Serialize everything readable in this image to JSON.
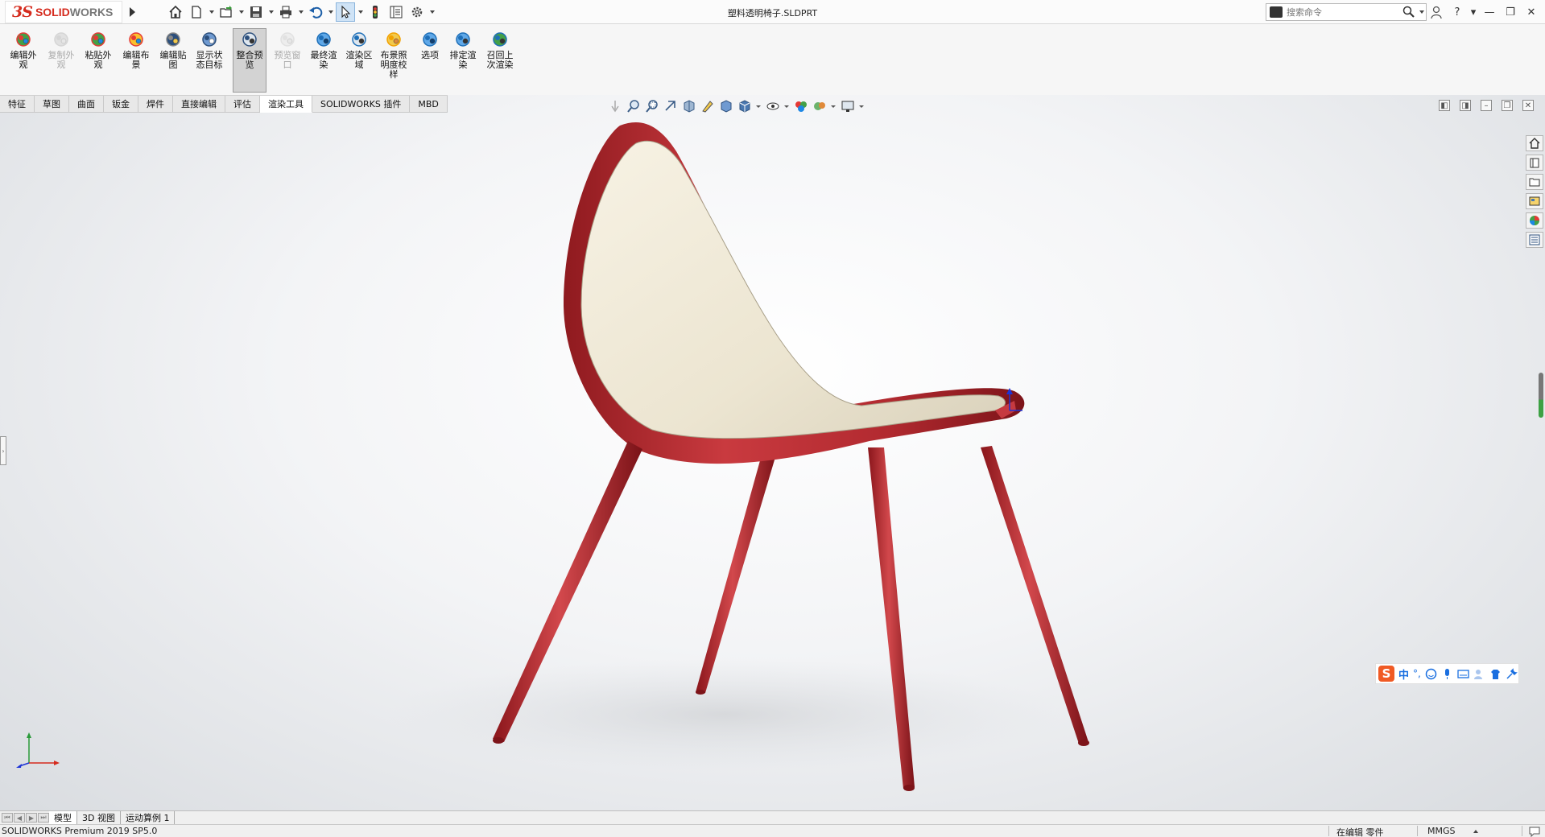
{
  "app": {
    "brand_ds": "3S",
    "brand_name_a": "SOLID",
    "brand_name_b": "WORKS",
    "document_title": "塑料透明椅子.SLDPRT"
  },
  "search": {
    "placeholder": "搜索命令"
  },
  "quick_access": [
    "home-icon",
    "new-document-icon",
    "open-icon",
    "save-icon",
    "print-icon",
    "undo-icon",
    "select-pointer-icon",
    "rebuild-icon",
    "file-properties-icon",
    "options-gear-icon"
  ],
  "ribbon": {
    "buttons": [
      {
        "label": "编辑外\n观",
        "icon": "edit-appearance-icon",
        "disabled": false
      },
      {
        "label": "复制外\n观",
        "icon": "copy-appearance-icon",
        "disabled": true
      },
      {
        "label": "粘贴外\n观",
        "icon": "paste-appearance-icon",
        "disabled": false
      },
      {
        "label": "编辑布\n景",
        "icon": "edit-scene-icon",
        "disabled": false
      },
      {
        "label": "编辑贴\n图",
        "icon": "edit-decal-icon",
        "disabled": false
      },
      {
        "label": "显示状\n态目标",
        "icon": "display-state-target-icon",
        "disabled": false
      },
      {
        "label": "整合预\n览",
        "icon": "integrated-preview-icon",
        "disabled": false,
        "pressed": true
      },
      {
        "label": "预览窗\n口",
        "icon": "preview-window-icon",
        "disabled": true
      },
      {
        "label": "最终渲\n染",
        "icon": "final-render-icon",
        "disabled": false
      },
      {
        "label": "渲染区\n域",
        "icon": "render-region-icon",
        "disabled": false
      },
      {
        "label": "布景照\n明度校\n样",
        "icon": "scene-illumination-proof-icon",
        "disabled": false
      },
      {
        "label": "选项",
        "icon": "render-options-icon",
        "disabled": false
      },
      {
        "label": "排定渲\n染",
        "icon": "schedule-render-icon",
        "disabled": false
      },
      {
        "label": "召回上\n次渲染",
        "icon": "recall-last-render-icon",
        "disabled": false
      }
    ]
  },
  "tabs": [
    {
      "label": "特征",
      "active": false
    },
    {
      "label": "草图",
      "active": false
    },
    {
      "label": "曲面",
      "active": false
    },
    {
      "label": "钣金",
      "active": false
    },
    {
      "label": "焊件",
      "active": false
    },
    {
      "label": "直接编辑",
      "active": false
    },
    {
      "label": "评估",
      "active": false
    },
    {
      "label": "渲染工具",
      "active": true
    },
    {
      "label": "SOLIDWORKS 插件",
      "active": false
    },
    {
      "label": "MBD",
      "active": false
    }
  ],
  "heads_up_toolbar": [
    "zoom-to-fit-icon",
    "zoom-area-icon",
    "previous-view-icon",
    "section-view-icon",
    "dynamic-annotation-icon",
    "view-orientation-icon",
    "display-style-icon",
    "hide-show-items-icon",
    "edit-appearance-icon",
    "apply-scene-icon",
    "view-settings-icon"
  ],
  "task_pane": [
    "solidworks-resources-icon",
    "design-library-icon",
    "file-explorer-icon",
    "view-palette-icon",
    "appearances-scenes-icon",
    "custom-properties-icon"
  ],
  "ime": {
    "logo": "S",
    "mode": "中",
    "punct": "°,"
  },
  "bottom_tabs": [
    {
      "label": "模型",
      "active": true
    },
    {
      "label": "3D 视图",
      "active": false
    },
    {
      "label": "运动算例 1",
      "active": false
    }
  ],
  "status": {
    "product": "SOLIDWORKS Premium 2019 SP5.0",
    "mode": "在编辑 零件",
    "units": "MMGS"
  },
  "colors": {
    "accent_red": "#b3232a",
    "seat_cream": "#efe9d8",
    "brand_red": "#d52b1e"
  }
}
